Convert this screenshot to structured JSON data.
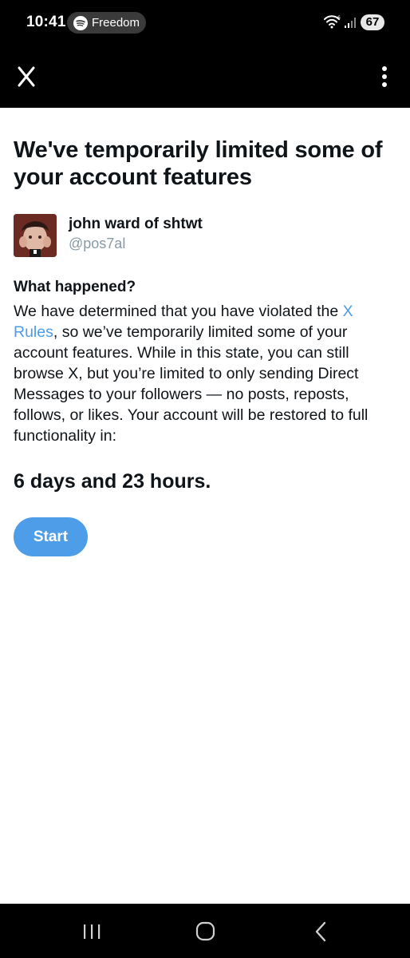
{
  "status_bar": {
    "time": "10:41",
    "media_app": "Freedom",
    "battery": "67",
    "icons": [
      "spotify-icon",
      "wifi-icon",
      "signal-icon",
      "battery-icon"
    ]
  },
  "app_bar": {
    "left_icon": "x-logo-icon",
    "right_icon": "more-vertical-icon"
  },
  "page": {
    "title": "We've temporarily limited some of your account features",
    "user": {
      "display_name": "john ward of shtwt",
      "handle": "@pos7al"
    },
    "section_heading": "What happened?",
    "body_before_link": "We have determined that you have violated the ",
    "rules_link": "X Rules",
    "body_after_link": ", so we’ve temporarily limited some of your account features. While in this state, you can still browse X, but you’re limited to only sending Direct Messages to your followers — no posts, reposts, follows, or likes. Your account will be restored to full functionality in:",
    "countdown": "6 days and 23 hours.",
    "start_label": "Start"
  },
  "colors": {
    "accent": "#4d9de8",
    "link": "#4c9be8",
    "text": "#0f1419",
    "secondary_text": "#8899a6",
    "bar_background": "#000000"
  },
  "nav_bar": {
    "icons": [
      "recents-icon",
      "home-icon",
      "back-icon"
    ]
  }
}
